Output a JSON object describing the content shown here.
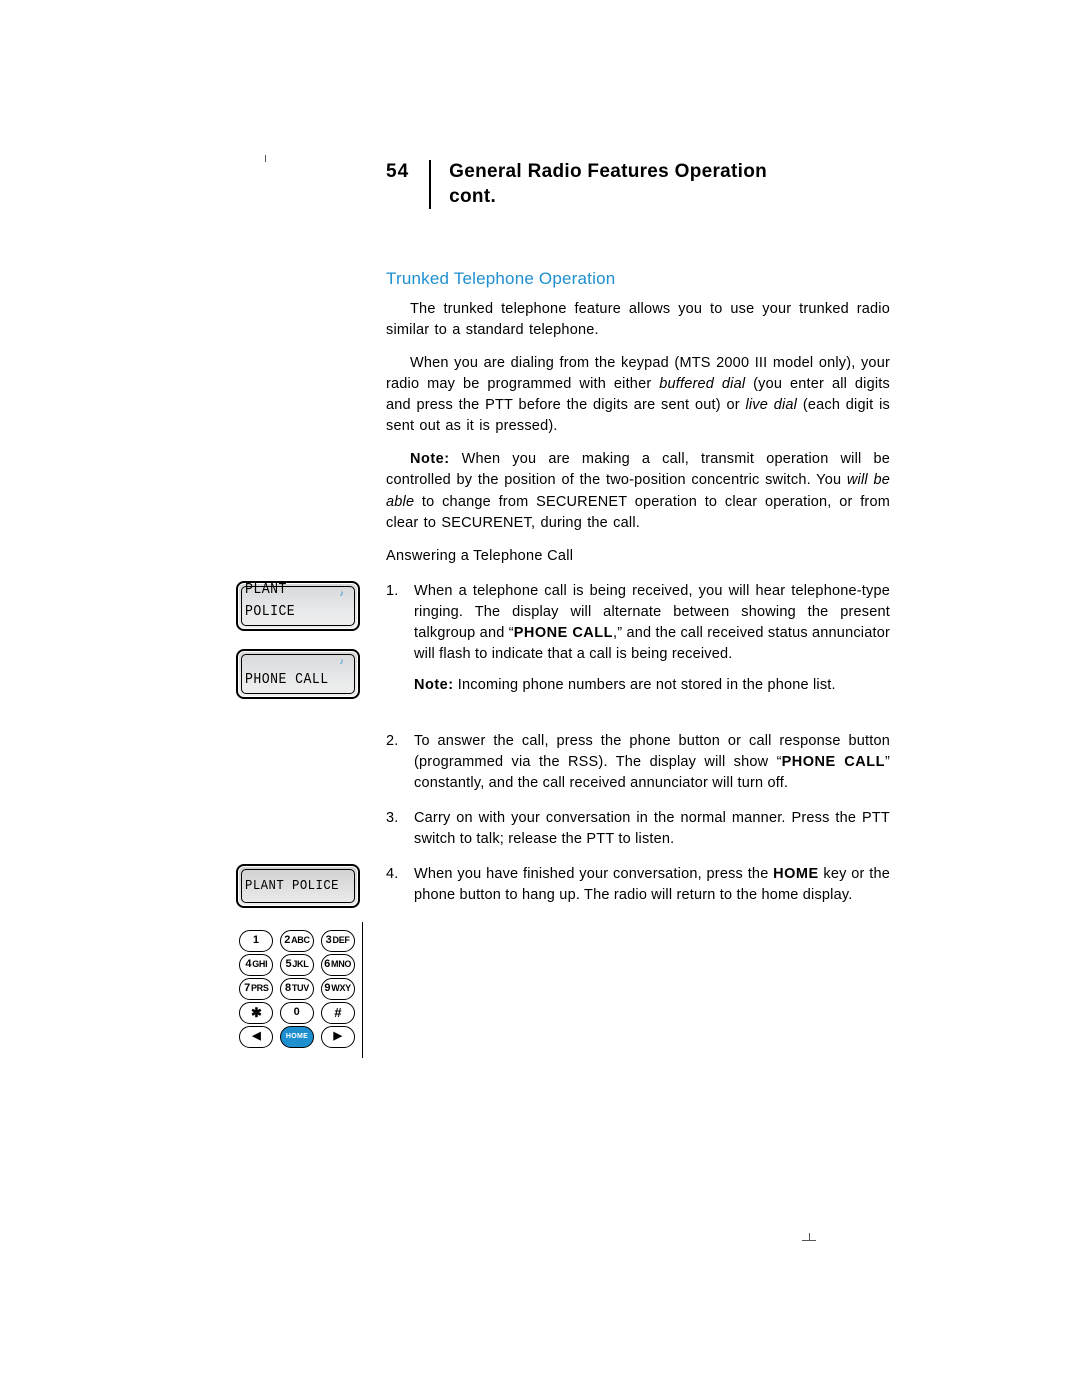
{
  "page_number": "54",
  "header_title_line1": "General Radio Features Operation",
  "header_title_line2": "cont.",
  "section_title": "Trunked Telephone Operation",
  "para1": "The trunked telephone feature allows you to use your trunked radio similar to a standard telephone.",
  "para2_a": "When you are dialing from the keypad (MTS 2000 III model only), your radio may be programmed with either ",
  "para2_bufdial": "buffered dial",
  "para2_b": " (you enter all digits and press the PTT before the digits are sent out) or ",
  "para2_livedial": "live dial",
  "para2_c": " (each digit is sent out as it is pressed).",
  "note1_label": "Note:",
  "note1_a": " When you are making a call, transmit operation will be controlled by the position of the two-position concentric switch. You ",
  "note1_willbeable": "will be able",
  "note1_b": " to change from SECURENET operation to clear operation, or from clear to SECURENET, during the call.",
  "answer_head": "Answering a Telephone Call",
  "step1_n": "1.",
  "step1_a": "When a telephone call is being received, you will hear telephone-type ringing. The display will alternate between showing the present talkgroup and “",
  "step1_phonecall": "PHONE CALL",
  "step1_b": ",” and the call received status annunciator will flash to indicate that a call is being received.",
  "step1_note_label": "Note:",
  "step1_note": " Incoming phone numbers are not stored in the phone list.",
  "step2_n": "2.",
  "step2_a": "To answer the call, press the phone button or call response button (programmed via the RSS). The display will show “",
  "step2_phonecall": "PHONE CALL",
  "step2_b": "” constantly, and the call received annunciator will turn off.",
  "step3_n": "3.",
  "step3": "Carry on with your conversation in the normal manner. Press the PTT switch to talk; release the PTT to listen.",
  "step4_n": "4.",
  "step4_a": "When you have finished your conversation, press the ",
  "step4_home": "HOME",
  "step4_b": " key or the phone button to hang up. The radio will return to the home display.",
  "lcd1": "PLANT POLICE",
  "lcd2": "PHONE CALL",
  "lcd3": "PLANT POLICE",
  "keypad": {
    "r1": [
      "1",
      "2ABC",
      "3DEF"
    ],
    "r2": [
      "4GHI",
      "5JKL",
      "6MNO"
    ],
    "r3": [
      "7PRS",
      "8TUV",
      "9WXY"
    ],
    "r4": [
      "✱",
      "0",
      "#"
    ],
    "r5_left": "◀",
    "r5_home": "HOME",
    "r5_right": "▶"
  },
  "note_icon": "♪"
}
